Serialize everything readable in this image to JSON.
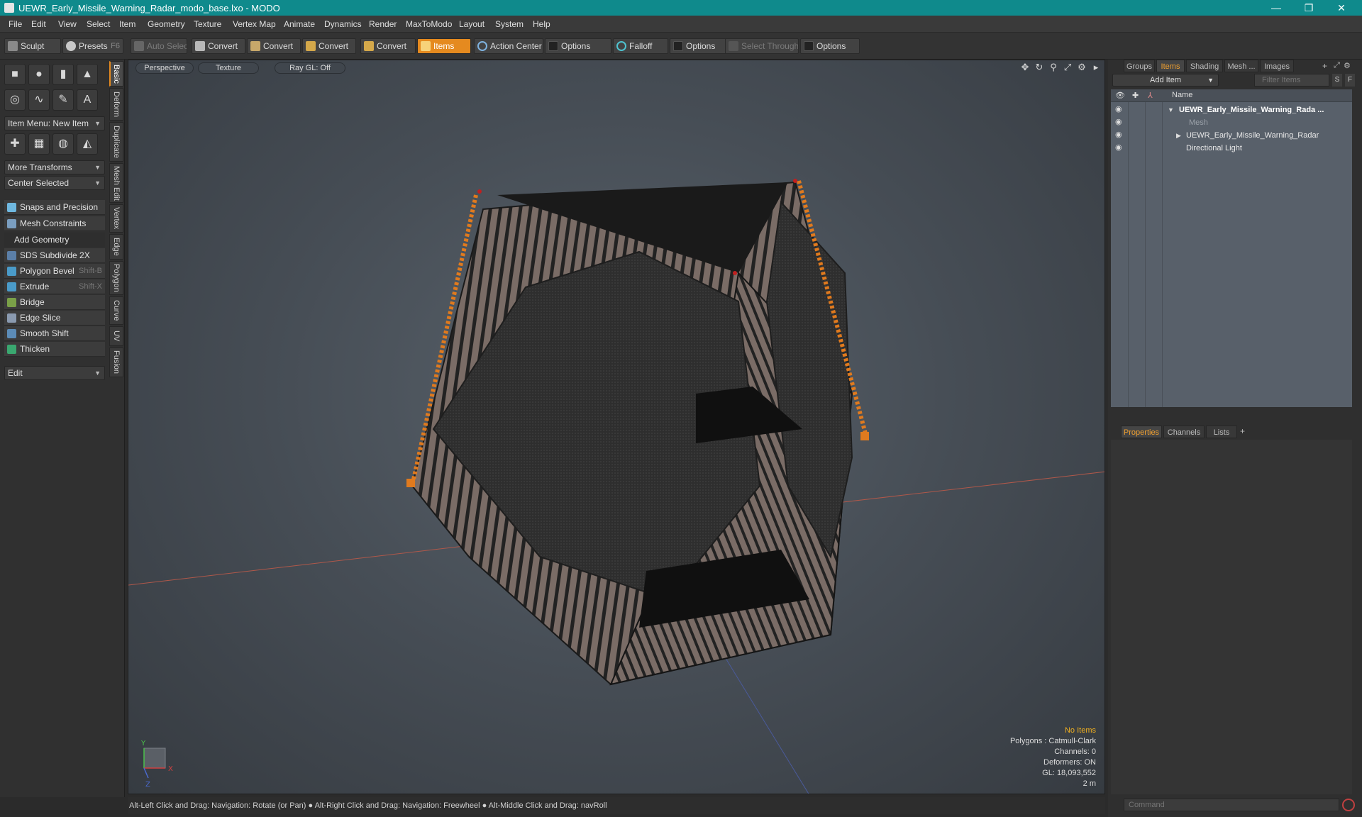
{
  "window": {
    "title": "UEWR_Early_Missile_Warning_Radar_modo_base.lxo - MODO",
    "minimize": "—",
    "restore": "❐",
    "close": "✕"
  },
  "menu": [
    "File",
    "Edit",
    "View",
    "Select",
    "Item",
    "Geometry",
    "Texture",
    "Vertex Map",
    "Animate",
    "Dynamics",
    "Render",
    "MaxToModo",
    "Layout",
    "System",
    "Help"
  ],
  "toolbar": {
    "sculpt": "Sculpt",
    "presets": "Presets",
    "presets_key": "F6",
    "auto_select": "Auto Select",
    "convert": "Convert",
    "items": "Items",
    "action_center": "Action Center",
    "options": "Options",
    "falloff": "Falloff",
    "select_through": "Select Through"
  },
  "left_panel": {
    "item_menu": "Item Menu: New Item",
    "more_transforms": "More Transforms",
    "center_selected": "Center Selected",
    "snaps": "Snaps and Precision",
    "mesh_constraints": "Mesh Constraints",
    "add_geometry": "Add Geometry",
    "tools": [
      {
        "label": "SDS Subdivide 2X",
        "key": "",
        "color": "#5b7fa8"
      },
      {
        "label": "Polygon Bevel",
        "key": "Shift-B",
        "color": "#4a9bc9"
      },
      {
        "label": "Extrude",
        "key": "Shift-X",
        "color": "#4a9bc9"
      },
      {
        "label": "Bridge",
        "key": "",
        "color": "#7aa048"
      },
      {
        "label": "Edge Slice",
        "key": "",
        "color": "#8a9ab0"
      },
      {
        "label": "Smooth Shift",
        "key": "",
        "color": "#5c8cb8"
      },
      {
        "label": "Thicken",
        "key": "",
        "color": "#3aa870"
      }
    ],
    "edit_dropdown": "Edit",
    "vertical_tabs": [
      "Basic",
      "Deform",
      "Duplicate",
      "Mesh Edit",
      "Vertex",
      "Edge",
      "Polygon",
      "Curve",
      "UV",
      "Fusion"
    ]
  },
  "viewport": {
    "tabs": [
      "Perspective",
      "Texture",
      "Ray GL: Off"
    ],
    "info": {
      "selection": "No Items",
      "polygons": "Polygons : Catmull-Clark",
      "channels": "Channels: 0",
      "deformers": "Deformers: ON",
      "gl": "GL: 18,093,552",
      "scale": "2 m"
    },
    "axis": {
      "y": "Y",
      "x": "X",
      "z": "Z"
    }
  },
  "status_bar": "Alt-Left Click and Drag: Navigation: Rotate (or Pan) ● Alt-Right Click and Drag: Navigation: Freewheel ● Alt-Middle Click and Drag: navRoll",
  "right_panel": {
    "tabs": [
      "Groups",
      "Items",
      "Shading",
      "Mesh ...",
      "Images"
    ],
    "add_item": "Add Item",
    "filter_placeholder": "Filter Items",
    "filter_s": "S",
    "filter_f": "F",
    "column_name": "Name",
    "tree": [
      {
        "label": "UEWR_Early_Missile_Warning_Rada ...",
        "bold": true,
        "indent": 0
      },
      {
        "label": "Mesh",
        "dim": true,
        "indent": 2
      },
      {
        "label": "UEWR_Early_Missile_Warning_Radar",
        "indent": 1
      },
      {
        "label": "Directional Light",
        "indent": 1
      }
    ],
    "bottom_tabs": [
      "Properties",
      "Channels",
      "Lists"
    ],
    "command_placeholder": "Command"
  }
}
